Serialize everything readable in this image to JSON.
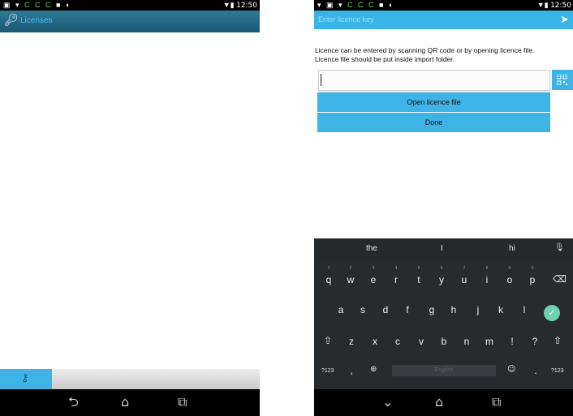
{
  "left_screen": {
    "status_bar": {
      "time": "12:50"
    },
    "header": {
      "title": "Licenses",
      "icon": "key-icon"
    },
    "bottom_bar": {
      "button_icon": "key-icon"
    },
    "nav_bar": {
      "icons": [
        "back-icon",
        "home-icon",
        "recent-apps-icon"
      ]
    }
  },
  "right_screen": {
    "status_bar": {
      "time": "12:50"
    },
    "header": {
      "input_placeholder": "Enter licence key",
      "send_icon": "send-icon"
    },
    "description": "Licence can be entered by scanning QR code or by opening licence file. Licence file should be put inside import folder.",
    "licence_input": {
      "value": ""
    },
    "qr_button": {
      "icon": "qr-code-icon"
    },
    "buttons": {
      "open": "Open licence file",
      "done": "Done"
    },
    "keyboard": {
      "suggestions": [
        "the",
        "I",
        "hi"
      ],
      "row1": [
        "q",
        "w",
        "e",
        "r",
        "t",
        "y",
        "u",
        "i",
        "o",
        "p"
      ],
      "row1_hints": [
        "1",
        "2",
        "3",
        "4",
        "5",
        "6",
        "7",
        "8",
        "9",
        "0"
      ],
      "row2": [
        "a",
        "s",
        "d",
        "f",
        "g",
        "h",
        "j",
        "k",
        "l"
      ],
      "row3": [
        "z",
        "x",
        "c",
        "v",
        "b",
        "n",
        "m",
        "!",
        "?"
      ],
      "bottom": {
        "symbols_left": "?123",
        "comma": ",",
        "space": "English",
        "period": ".",
        "symbols_right": "?123"
      }
    },
    "nav_bar": {
      "icons": [
        "back-icon",
        "home-icon",
        "recent-apps-icon"
      ]
    }
  },
  "colors": {
    "accent": "#3eb3e6",
    "header_dark": "#1a5772",
    "keyboard_bg": "#272b2e",
    "enter_key": "#6dd1ad"
  }
}
